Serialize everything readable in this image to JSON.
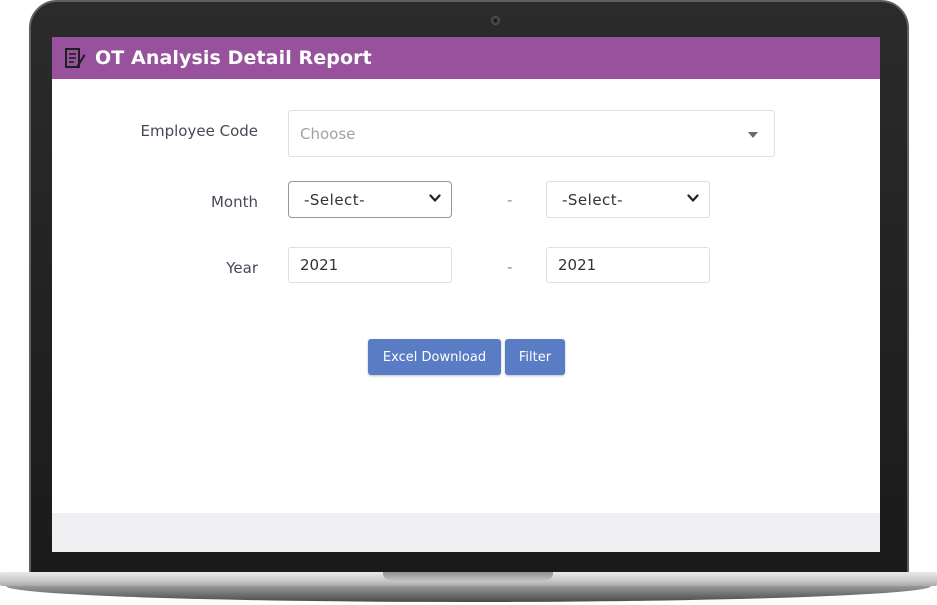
{
  "header": {
    "title": "OT Analysis Detail Report",
    "icon": "report-edit-icon"
  },
  "form": {
    "employee_code": {
      "label": "Employee Code",
      "placeholder": "Choose"
    },
    "month": {
      "label": "Month",
      "from_value": "-Select-",
      "to_value": "-Select-",
      "separator": "-"
    },
    "year": {
      "label": "Year",
      "from_value": "2021",
      "to_value": "2021",
      "separator": "-"
    }
  },
  "actions": {
    "excel_download_label": "Excel Download",
    "filter_label": "Filter"
  },
  "colors": {
    "header_bg": "#97519d",
    "button_bg": "#5a7cc4",
    "footer_bg": "#f0f0f2"
  }
}
